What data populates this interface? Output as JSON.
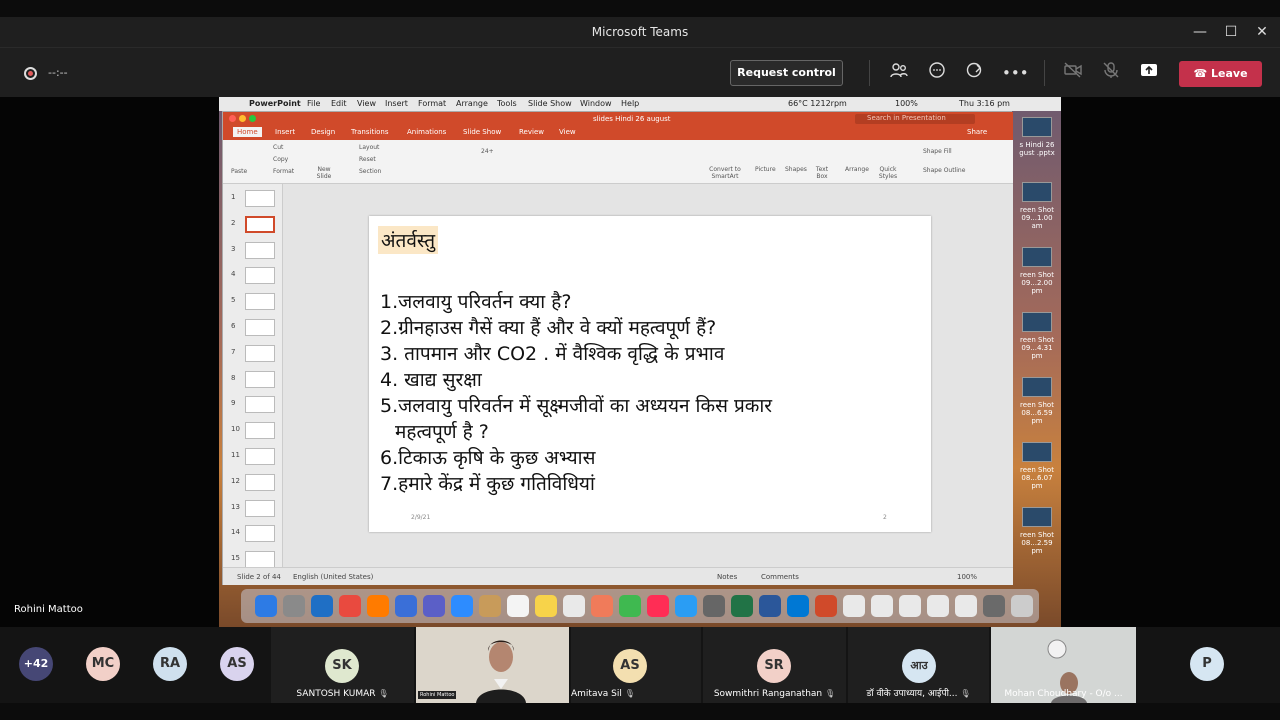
{
  "window": {
    "title": "Microsoft Teams",
    "minimize": "—",
    "maximize": "☐",
    "close": "✕"
  },
  "call": {
    "timer": "--:--",
    "request_control": "Request control",
    "leave": "Leave"
  },
  "presenter_name": "Rohini Mattoo",
  "mac_menubar": {
    "app": "PowerPoint",
    "menus": [
      "File",
      "Edit",
      "View",
      "Insert",
      "Format",
      "Arrange",
      "Tools",
      "Slide Show",
      "Window",
      "Help"
    ],
    "status": "66°C 1212rpm",
    "battery": "100%",
    "clock": "Thu 3:16 pm"
  },
  "ppt": {
    "doc_title": "slides Hindi 26 august",
    "search_placeholder": "Search in Presentation",
    "share": "Share",
    "tabs": [
      "Home",
      "Insert",
      "Design",
      "Transitions",
      "Animations",
      "Slide Show",
      "Review",
      "View"
    ],
    "ribbon": {
      "paste": "Paste",
      "cut": "Cut",
      "copy": "Copy",
      "format": "Format",
      "new_slide": "New Slide",
      "layout": "Layout",
      "reset": "Reset",
      "section": "Section",
      "font_size": "24+",
      "convert": "Convert to SmartArt",
      "picture": "Picture",
      "shapes": "Shapes",
      "text_box": "Text Box",
      "arrange": "Arrange",
      "quick_styles": "Quick Styles",
      "shape_fill": "Shape Fill",
      "shape_outline": "Shape Outline"
    },
    "slide_numbers": [
      "1",
      "2",
      "3",
      "4",
      "5",
      "6",
      "7",
      "8",
      "9",
      "10",
      "11",
      "12",
      "13",
      "14",
      "15"
    ],
    "selected_slide": 2,
    "slide": {
      "title": "अंतर्वस्तु",
      "lines": [
        "1.जलवायु परिवर्तन क्या है?",
        "2.ग्रीनहाउस गैसें क्या हैं और वे क्यों महत्वपूर्ण हैं?",
        "3. तापमान और CO2 . में वैश्विक वृद्धि के प्रभाव",
        "4. खाद्य सुरक्षा",
        "5.जलवायु परिवर्तन में सूक्ष्मजीवों का अध्ययन किस प्रकार",
        "   महत्वपूर्ण है ?",
        "6.टिकाऊ कृषि के कुछ अभ्यास",
        "7.हमारे केंद्र में कुछ गतिविधियां"
      ],
      "date": "2/9/21",
      "page": "2"
    },
    "statusbar": {
      "slide_info": "Slide 2 of 44",
      "language": "English (United States)",
      "notes": "Notes",
      "comments": "Comments",
      "zoom": "100%"
    }
  },
  "desktop_items": [
    {
      "label": "s Hindi 26 gust .pptx"
    },
    {
      "label": "reen Shot 09...1.00 am"
    },
    {
      "label": "reen Shot 09...2.00 pm"
    },
    {
      "label": "reen Shot 09...4.31 pm"
    },
    {
      "label": "reen Shot 08...6.59 pm"
    },
    {
      "label": "reen Shot 08...6.07 pm"
    },
    {
      "label": "reen Shot 08...2.59 pm"
    }
  ],
  "participants": {
    "overflow": "+42",
    "avatars": [
      {
        "initials": "MC",
        "color": "#f2d0c8"
      },
      {
        "initials": "RA",
        "color": "#cfe0ee"
      },
      {
        "initials": "AS",
        "color": "#d9d3ee"
      }
    ],
    "tiles": [
      {
        "initials": "SK",
        "name": "SANTOSH KUMAR",
        "color": "#dfe8cf"
      },
      {
        "initials": "",
        "name": "Rohini Mattoo",
        "video": true
      },
      {
        "initials": "AS",
        "name": "Amitava Sil",
        "color": "#f3dfb0"
      },
      {
        "initials": "SR",
        "name": "Sowmithri Ranganathan",
        "color": "#f2d0c8"
      },
      {
        "initials": "आउ",
        "name": "डॉ वीके उपाध्याय, आईपी...",
        "color": "#d6e6f2"
      },
      {
        "initials": "",
        "name": "Mohan Choudhary - O/o ...",
        "video": true
      }
    ],
    "last": {
      "initials": "P",
      "color": "#d6e6f2"
    }
  }
}
